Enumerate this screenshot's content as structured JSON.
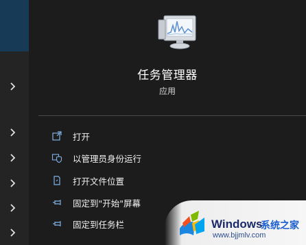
{
  "app": {
    "title": "任务管理器",
    "type_label": "应用"
  },
  "actions": [
    {
      "label": "打开",
      "icon": "open-icon"
    },
    {
      "label": "以管理员身份运行",
      "icon": "shield-icon"
    },
    {
      "label": "打开文件位置",
      "icon": "file-location-icon"
    },
    {
      "label": "固定到\"开始\"屏幕",
      "icon": "pin-icon"
    },
    {
      "label": "固定到任务栏",
      "icon": "pin-icon"
    }
  ],
  "left_strip": {
    "chevrons": [
      "chevron-right-icon",
      "chevron-right-icon",
      "chevron-right-icon",
      "chevron-right-icon",
      "chevron-right-icon",
      "chevron-right-icon"
    ]
  },
  "watermark": {
    "brand": "Windows",
    "site_name": "系统之家",
    "url": "www.bjjmlv.com"
  },
  "colors": {
    "background": "#1c1c1c",
    "left_strip": "#242424",
    "selected": "#173a57",
    "divider": "#4a4a4a",
    "icon_accent": "#7fb2e5"
  }
}
